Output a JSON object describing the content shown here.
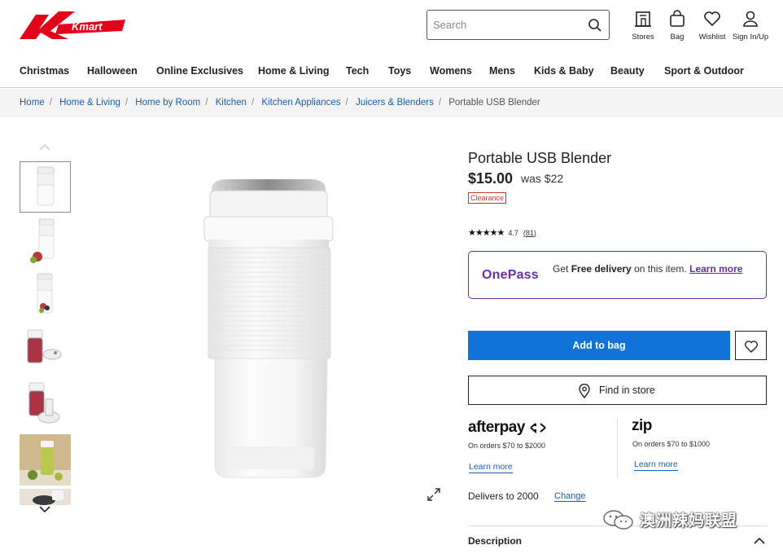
{
  "header": {
    "logo_text": "Kmart",
    "search_placeholder": "Search",
    "utilities": [
      {
        "label": "Stores",
        "icon": "store-icon"
      },
      {
        "label": "Bag",
        "icon": "bag-icon"
      },
      {
        "label": "Wishlist",
        "icon": "heart-icon"
      },
      {
        "label": "Sign In/Up",
        "icon": "user-icon"
      }
    ],
    "nav": [
      "Christmas",
      "Halloween",
      "Online Exclusives",
      "Home & Living",
      "Tech",
      "Toys",
      "Womens",
      "Mens",
      "Kids & Baby",
      "Beauty",
      "Sport & Outdoor"
    ]
  },
  "breadcrumb": [
    "Home",
    "Home & Living",
    "Home by Room",
    "Kitchen",
    "Kitchen Appliances",
    "Juicers & Blenders",
    "Portable USB Blender"
  ],
  "product": {
    "title": "Portable USB Blender",
    "price": "$15.00",
    "was_price": "was $22",
    "badge": "Clearance",
    "rating": "4.7",
    "review_count": "81",
    "stars": "★★★★★"
  },
  "onepass": {
    "logo": "OnePass",
    "text_prefix": "Get ",
    "text_bold": "Free delivery",
    "text_suffix": " on this item. ",
    "link": "Learn more",
    "color": "#6b2da8"
  },
  "actions": {
    "add_to_bag": "Add to bag",
    "find_in_store": "Find in store",
    "accent_color": "#0e72d6"
  },
  "payments": {
    "afterpay": {
      "logo": "afterpay",
      "terms": "On orders $70 to $2000",
      "link": "Learn more"
    },
    "zip": {
      "logo": "zip",
      "terms": "On orders $70 to $1000",
      "link": "Learn more"
    }
  },
  "delivery": {
    "text": "Delivers to 2000",
    "change": "Change"
  },
  "description": {
    "label": "Description"
  },
  "watermark": "澳洲辣妈联盟"
}
